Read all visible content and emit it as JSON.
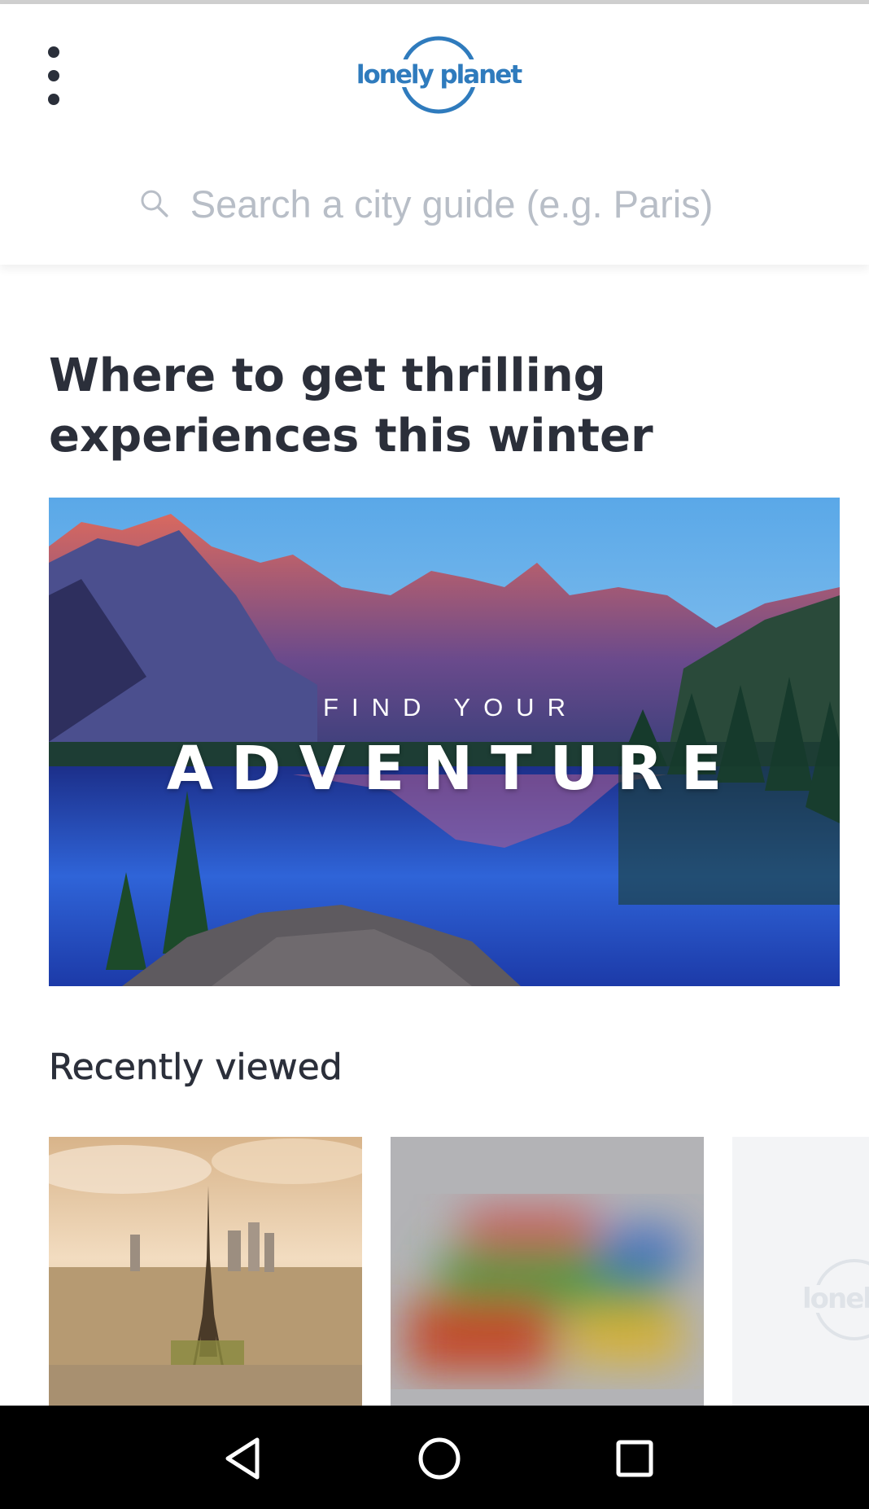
{
  "header": {
    "logo_text": "lonely planet",
    "menu_icon": "more-vert-icon"
  },
  "search": {
    "placeholder": "Search a city guide (e.g. Paris)",
    "icon": "search-icon"
  },
  "featured": {
    "headline": "Where to get thrilling experiences this winter",
    "hero_kicker": "FIND YOUR",
    "hero_title": "ADVENTURE"
  },
  "recent": {
    "title": "Recently viewed",
    "cards": [
      {
        "image": "paris-eiffel-tower"
      },
      {
        "image": "blurred-loading"
      },
      {
        "image": "lonely-planet-placeholder",
        "logo_text": "lonely planet"
      }
    ]
  },
  "system_nav": {
    "back_icon": "back-triangle-icon",
    "home_icon": "home-circle-icon",
    "recents_icon": "recents-square-icon"
  },
  "colors": {
    "brand_blue": "#2f7bbd",
    "text_dark": "#2b2f3a",
    "placeholder_grey": "#b8bec7"
  }
}
